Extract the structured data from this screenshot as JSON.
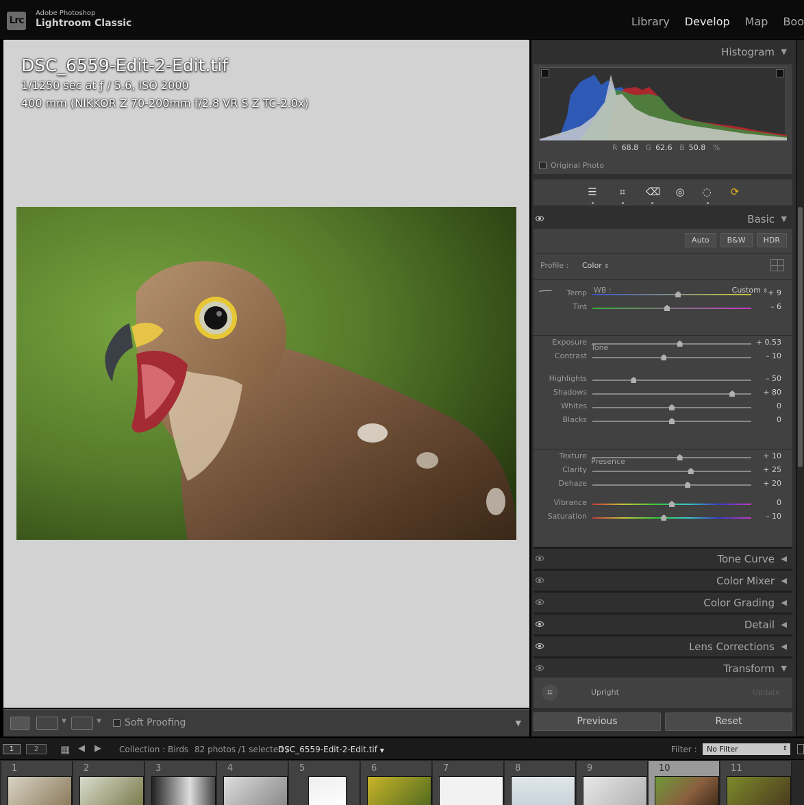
{
  "app": {
    "brand_top": "Adobe Photoshop",
    "brand_main": "Lightroom Classic",
    "logo_text": "Lrc",
    "modules": [
      "Library",
      "Develop",
      "Map",
      "Boo"
    ],
    "active_module": "Develop"
  },
  "image_info": {
    "filename": "DSC_6559-Edit-2-Edit.tif",
    "exposure_line": "1/1250 sec at ƒ / 5.6, ISO 2000",
    "lens_line": "400 mm (NIKKOR Z 70-200mm f/2.8 VR S Z TC-2.0x)"
  },
  "toolbar": {
    "soft_proofing": "Soft Proofing"
  },
  "histogram": {
    "title": "Histogram",
    "r_label": "R",
    "r_value": "68.8",
    "g_label": "G",
    "g_value": "62.6",
    "b_label": "B",
    "b_value": "50.8",
    "unit": "%",
    "original_photo": "Original Photo"
  },
  "basic": {
    "title": "Basic",
    "auto": "Auto",
    "bw": "B&W",
    "hdr": "HDR",
    "profile_label": "Profile :",
    "profile_value": "Color",
    "wb_label": "WB :",
    "wb_value": "Custom",
    "tone_label": "Tone",
    "presence_label": "Presence",
    "sliders": [
      {
        "label": "Temp",
        "value": "+ 9",
        "pos": 0.54
      },
      {
        "label": "Tint",
        "value": "– 6",
        "pos": 0.47
      },
      {
        "label": "Exposure",
        "value": "+ 0.53",
        "pos": 0.55
      },
      {
        "label": "Contrast",
        "value": "– 10",
        "pos": 0.45
      },
      {
        "label": "Highlights",
        "value": "– 50",
        "pos": 0.26
      },
      {
        "label": "Shadows",
        "value": "+ 80",
        "pos": 0.88
      },
      {
        "label": "Whites",
        "value": "0",
        "pos": 0.5
      },
      {
        "label": "Blacks",
        "value": "0",
        "pos": 0.5
      },
      {
        "label": "Texture",
        "value": "+ 10",
        "pos": 0.55
      },
      {
        "label": "Clarity",
        "value": "+ 25",
        "pos": 0.62
      },
      {
        "label": "Dehaze",
        "value": "+ 20",
        "pos": 0.6
      },
      {
        "label": "Vibrance",
        "value": "0",
        "pos": 0.5
      },
      {
        "label": "Saturation",
        "value": "– 10",
        "pos": 0.45
      }
    ]
  },
  "sections": {
    "tone_curve": "Tone Curve",
    "color_mixer": "Color Mixer",
    "color_grading": "Color Grading",
    "detail": "Detail",
    "lens_corrections": "Lens Corrections",
    "transform": "Transform",
    "upright": "Upright",
    "update": "Update"
  },
  "footer": {
    "previous": "Previous",
    "reset": "Reset"
  },
  "filmbar": {
    "screen1": "1",
    "screen2": "2",
    "collection": "Collection : Birds",
    "count": "82 photos /1 selected /",
    "current_file": "DSC_6559-Edit-2-Edit.tif",
    "filter_label": "Filter :",
    "filter_value": "No Filter"
  },
  "filmstrip": {
    "cells": [
      "1",
      "2",
      "3",
      "4",
      "5",
      "6",
      "7",
      "8",
      "9",
      "10",
      "11"
    ],
    "selected_index": 9
  },
  "colors": {
    "accent_sync": "#e0b220",
    "histogram_blue": "#2f5fc4",
    "histogram_red": "#c0272d",
    "histogram_green": "#3f8a3f"
  }
}
